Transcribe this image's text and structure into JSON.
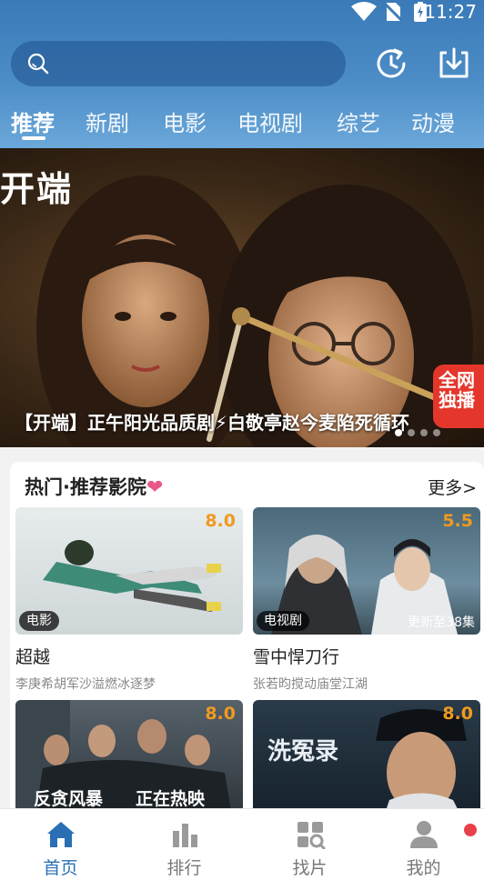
{
  "status": {
    "time": "11:27"
  },
  "tabs": [
    {
      "label": "推荐"
    },
    {
      "label": "新剧"
    },
    {
      "label": "电影"
    },
    {
      "label": "电视剧"
    },
    {
      "label": "综艺"
    },
    {
      "label": "动漫"
    }
  ],
  "banner": {
    "logo_text": "开端",
    "caption": "【开端】正午阳光品质剧⚡白敬亭赵今麦陷死循环",
    "badge": "全网独播"
  },
  "section": {
    "title": "热门·推荐影院",
    "more": "更多>"
  },
  "movies": [
    {
      "title": "超越",
      "subtitle": "李庚希胡军沙溢燃冰逐梦",
      "score": "8.0",
      "tag": "电影",
      "update": ""
    },
    {
      "title": "雪中悍刀行",
      "subtitle": "张若昀搅动庙堂江湖",
      "score": "5.5",
      "tag": "电视剧",
      "update": "更新至38集"
    },
    {
      "title": "",
      "subtitle": "",
      "score": "8.0",
      "tag": "",
      "update": "",
      "poster_text_1": "反贪风暴",
      "poster_text_2": "正在热映"
    },
    {
      "title": "",
      "subtitle": "",
      "score": "8.0",
      "tag": "",
      "update": "",
      "poster_text_1": "洗冤录"
    }
  ],
  "bottom_nav": [
    {
      "label": "首页",
      "icon": "home-icon"
    },
    {
      "label": "排行",
      "icon": "chart-icon"
    },
    {
      "label": "找片",
      "icon": "find-icon"
    },
    {
      "label": "我的",
      "icon": "user-icon"
    }
  ],
  "colors": {
    "accent": "#2a6fb3",
    "score": "#f19a1e",
    "header": "#4c8dc6"
  }
}
